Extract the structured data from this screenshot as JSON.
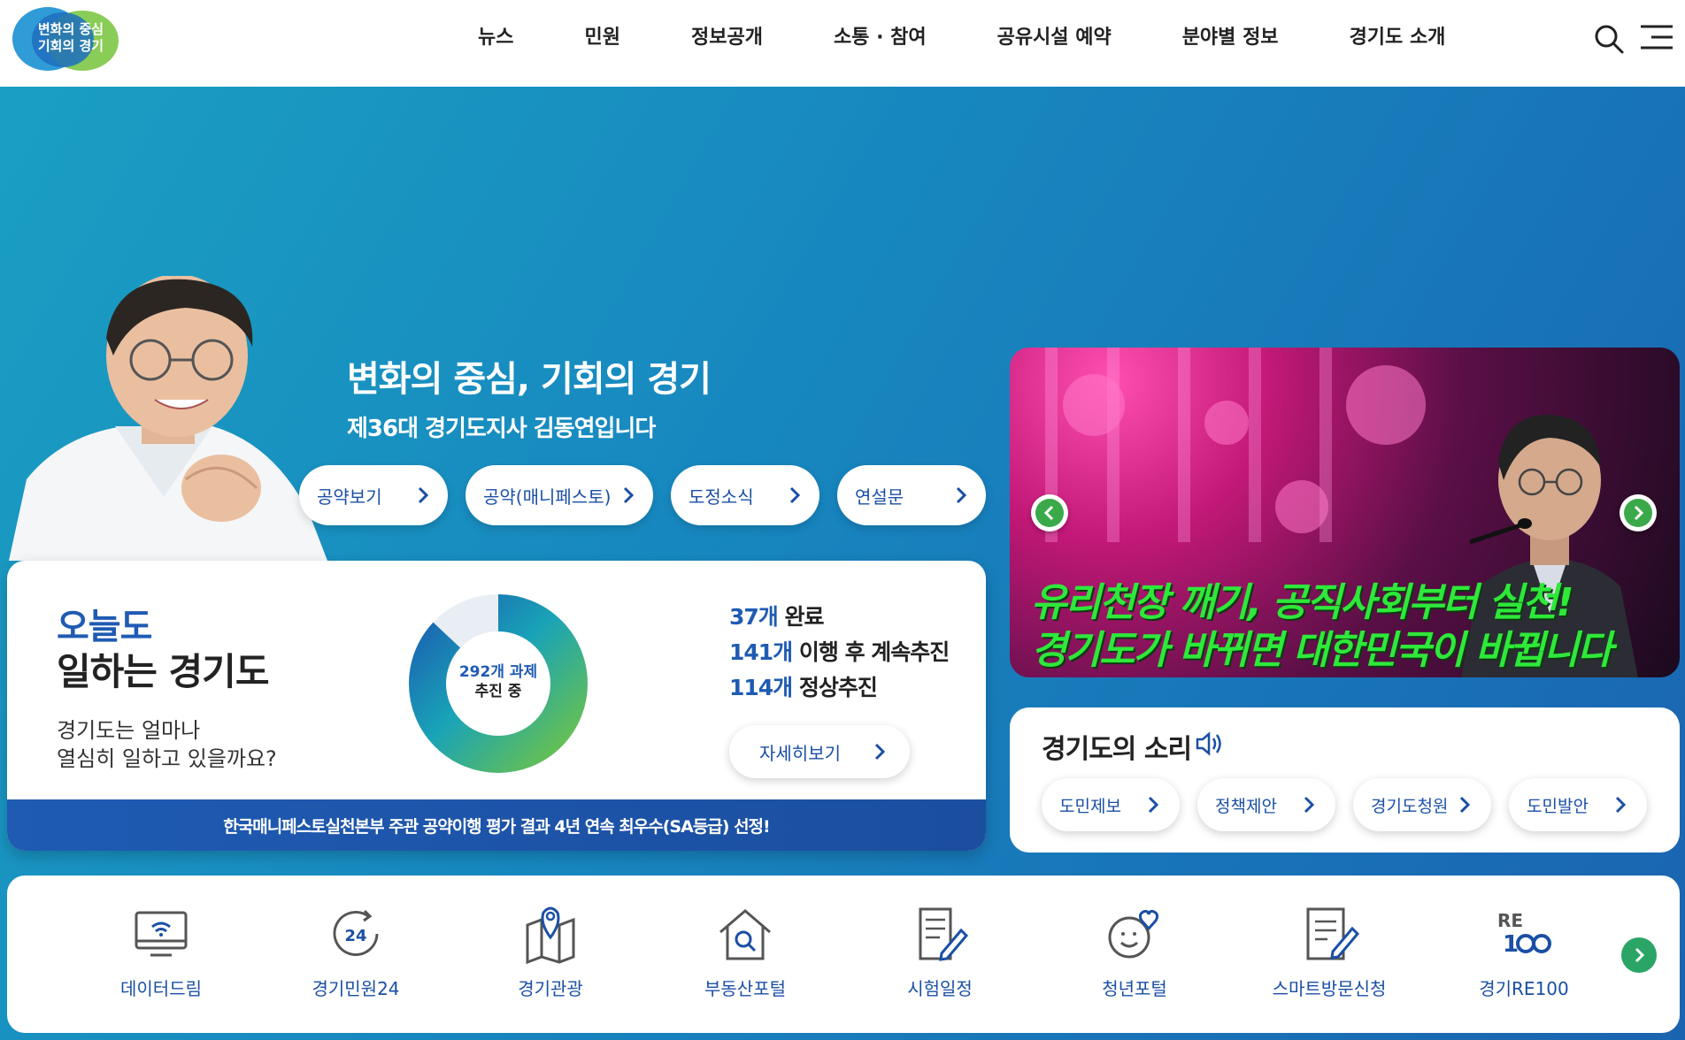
{
  "logo": {
    "text": "변화의 중심\n기회의 경기",
    "line1": "변화의 중심",
    "line2": "기회의 경기"
  },
  "nav": {
    "items": [
      "뉴스",
      "민원",
      "정보공개",
      "소통 · 참여",
      "공유시설 예약",
      "분야별 정보",
      "경기도 소개"
    ]
  },
  "hero": {
    "title": "변화의 중심, 기회의 경기",
    "subtitle": "제36대 경기도지사 김동연입니다",
    "buttons": [
      "공약보기",
      "공약(매니페스토)",
      "도정소식",
      "연설문"
    ]
  },
  "stats": {
    "heading_blue": "오늘도",
    "heading_black": "일하는 경기도",
    "question_line1": "경기도는 얼마나",
    "question_line2": "열심히 일하고 있을까요?",
    "donut_line1": "292개 과제",
    "donut_line2": "추진 중",
    "donut_progress_fraction": 0.87,
    "lines": [
      {
        "num": "37개",
        "text": " 완료"
      },
      {
        "num": "141개",
        "text": " 이행 후 계속추진"
      },
      {
        "num": "114개",
        "text": " 정상추진"
      }
    ],
    "detail_button": "자세히보기",
    "banner": "한국매니페스토실천본부 주관 공약이행 평가 결과 4년 연속 최우수(SA등급) 선정!"
  },
  "slider": {
    "caption_line1": "유리천장 깨기, 공직사회부터 실천!",
    "caption_line2": "경기도가 바뀌면 대한민국이 바뀝니다"
  },
  "voice": {
    "title": "경기도의 소리",
    "buttons": [
      "도민제보",
      "정책제안",
      "경기도청원",
      "도민발안"
    ]
  },
  "quick": {
    "items": [
      "데이터드림",
      "경기민원24",
      "경기관광",
      "부동산포털",
      "시험일정",
      "청년포털",
      "스마트방문신청",
      "경기RE100"
    ]
  },
  "colors": {
    "brand_blue": "#1f5bb3",
    "hero_gradient_start": "#1a9fc2",
    "hero_gradient_end": "#1a63b0",
    "accent_green": "#3aa94a",
    "caption_green": "#2ee83a"
  }
}
